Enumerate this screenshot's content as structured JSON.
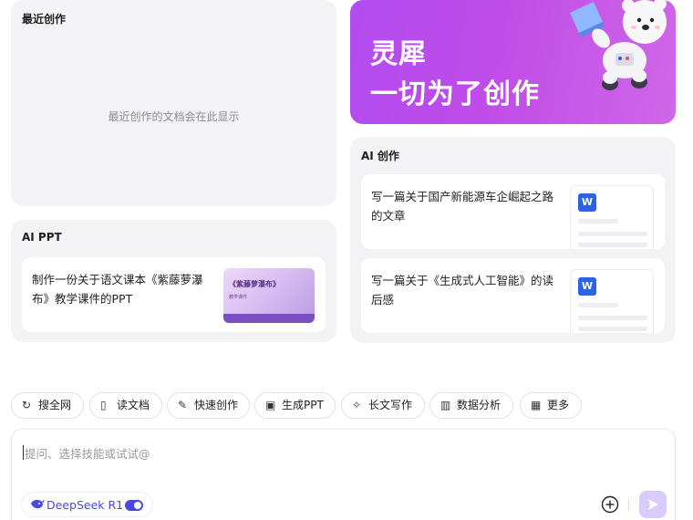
{
  "recent": {
    "title": "最近创作",
    "empty_text": "最近创作的文档会在此显示"
  },
  "banner": {
    "line1": "灵犀",
    "line2": "一切为了创作",
    "mascot_icon": "astronaut-bear-mascot-icon"
  },
  "ai_ppt": {
    "title": "AI PPT",
    "card_text": "制作一份关于语文课本《紫藤萝瀑布》教学课件的PPT",
    "thumb_title": "《紫藤萝瀑布》",
    "thumb_subtitle": "教学课件"
  },
  "ai_create": {
    "title": "AI 创作",
    "cards": [
      {
        "text": "写一篇关于国产新能源车企崛起之路的文章",
        "icon_letter": "W"
      },
      {
        "text": "写一篇关于《生成式人工智能》的读后感",
        "icon_letter": "W"
      }
    ]
  },
  "chips": [
    {
      "icon": "search-refresh-icon",
      "label": "搜全网"
    },
    {
      "icon": "book-icon",
      "label": "读文档"
    },
    {
      "icon": "pen-icon",
      "label": "快速创作"
    },
    {
      "icon": "ppt-icon",
      "label": "生成PPT"
    },
    {
      "icon": "sparkle-icon",
      "label": "长文写作"
    },
    {
      "icon": "data-chart-icon",
      "label": "数据分析"
    },
    {
      "icon": "grid-more-icon",
      "label": "更多"
    }
  ],
  "composer": {
    "placeholder": "提问、选择技能或试试@",
    "model_name": "DeepSeek R1",
    "model_toggle_on": true
  },
  "colors": {
    "accent": "#4b48e0",
    "banner_start": "#b24cf0",
    "banner_end": "#d067e8",
    "word_blue": "#2b63e8",
    "panel_bg": "#f3f3f5"
  }
}
